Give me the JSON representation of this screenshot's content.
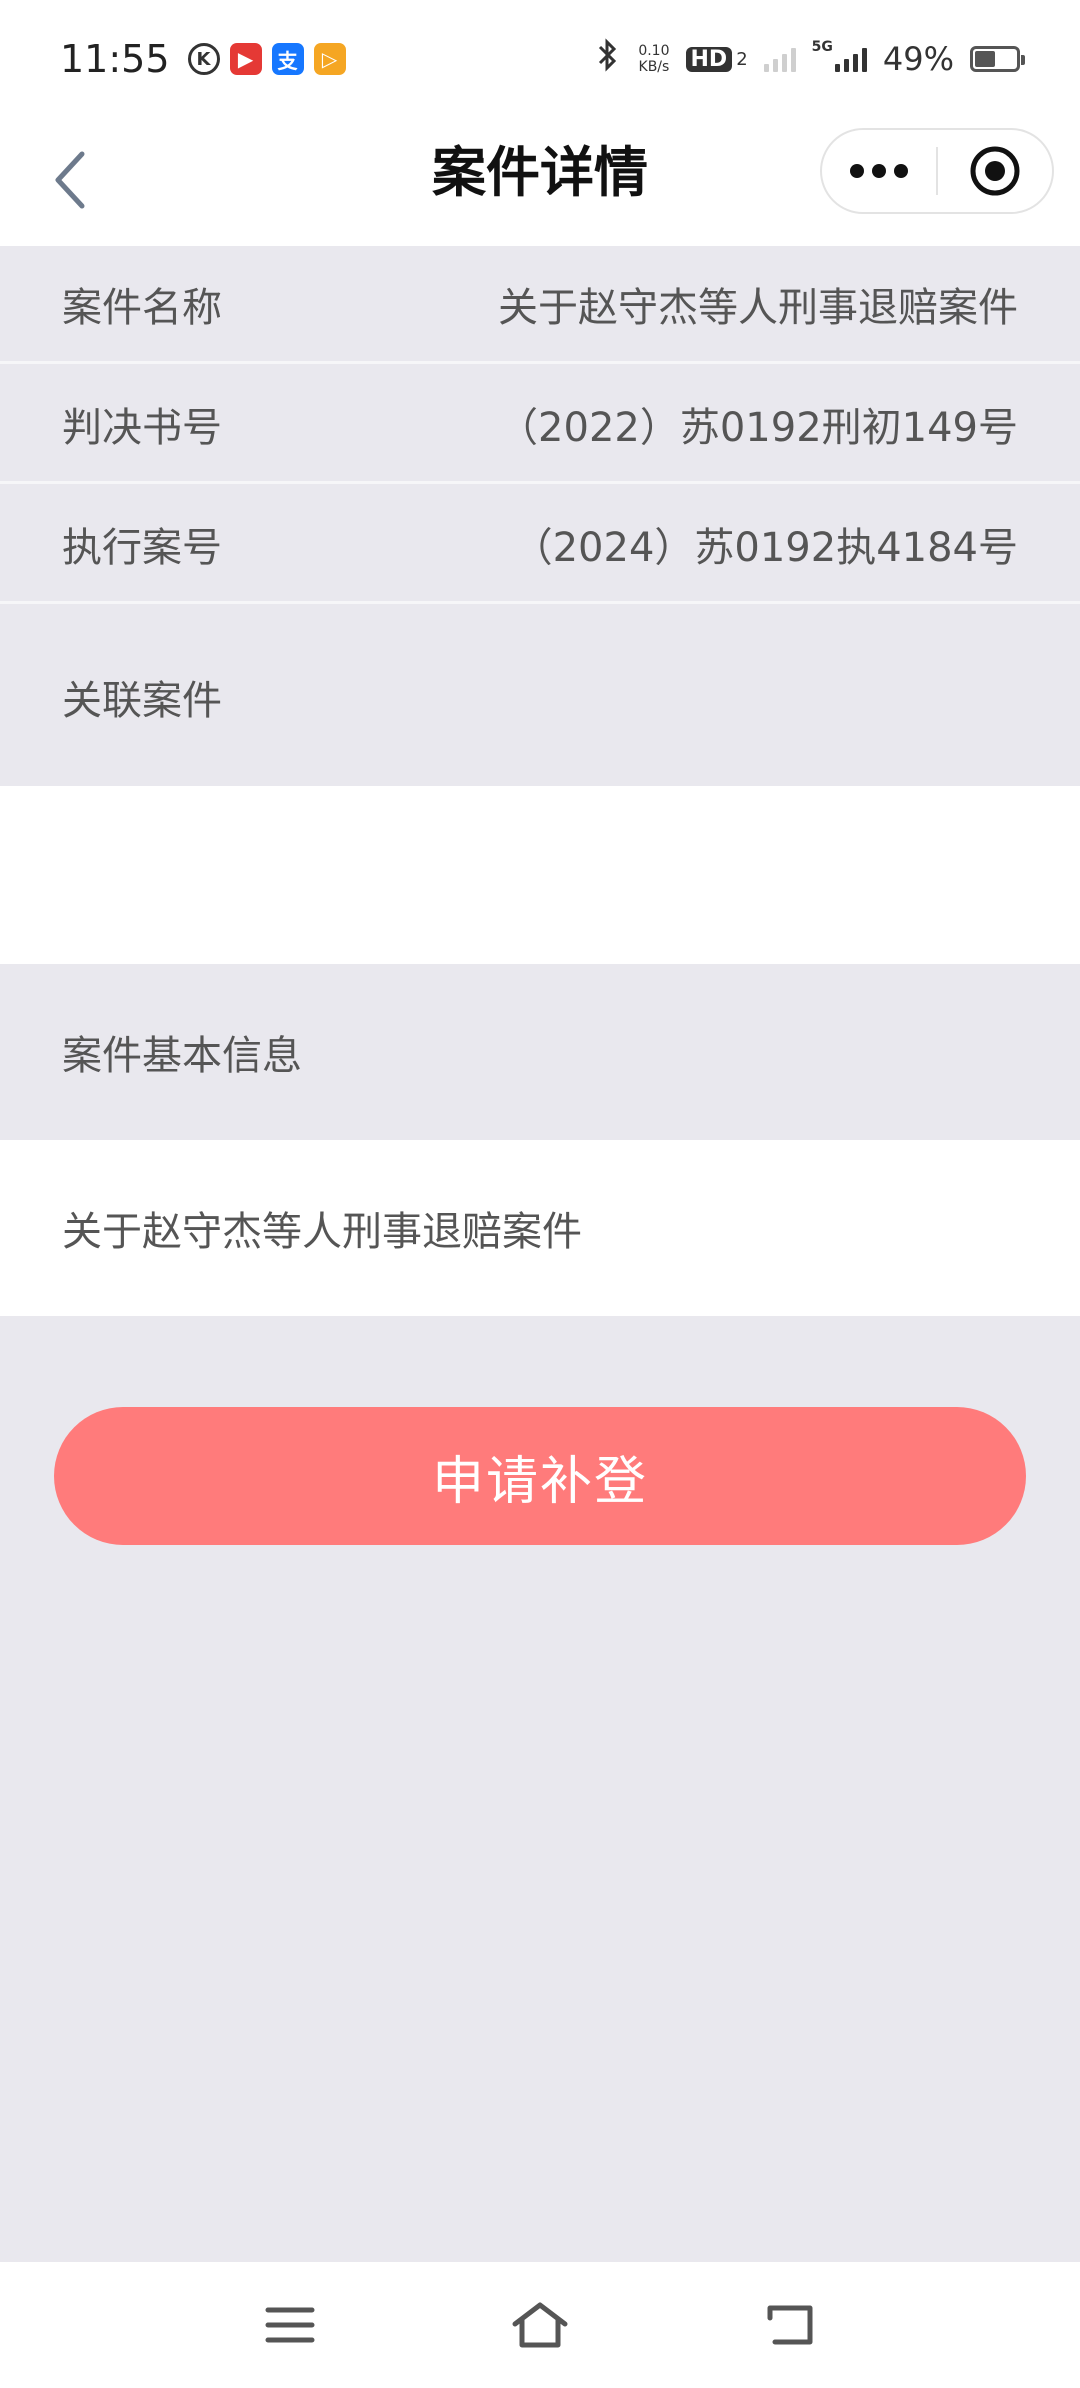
{
  "status_bar": {
    "time": "11:55",
    "app_icons": [
      {
        "name": "k-app-icon",
        "glyph": "K",
        "color": "#ffffff"
      },
      {
        "name": "video-app-icon",
        "glyph": "▶",
        "color": "#e53935"
      },
      {
        "name": "alipay-icon",
        "glyph": "支",
        "color": "#1677ff"
      },
      {
        "name": "player-app-icon",
        "glyph": "▷",
        "color": "#f5a623"
      }
    ],
    "net_speed_value": "0.10",
    "net_speed_unit": "KB/s",
    "hd_label": "HD",
    "hd_sub": "2",
    "network": "5G",
    "battery_percent": "49%",
    "battery_level": 0.49
  },
  "nav": {
    "title": "案件详情"
  },
  "details": {
    "rows": [
      {
        "label": "案件名称",
        "value": "关于赵守杰等人刑事退赔案件"
      },
      {
        "label": "判决书号",
        "value": "（2022）苏0192刑初149号"
      },
      {
        "label": "执行案号",
        "value": "（2024）苏0192执4184号"
      }
    ],
    "related_label": "关联案件",
    "basic_info_label": "案件基本信息",
    "basic_info_value": "关于赵守杰等人刑事退赔案件"
  },
  "actions": {
    "apply_label": "申请补登"
  },
  "colors": {
    "primary_button": "#ff7b7b",
    "page_background": "#e9e8ee"
  }
}
